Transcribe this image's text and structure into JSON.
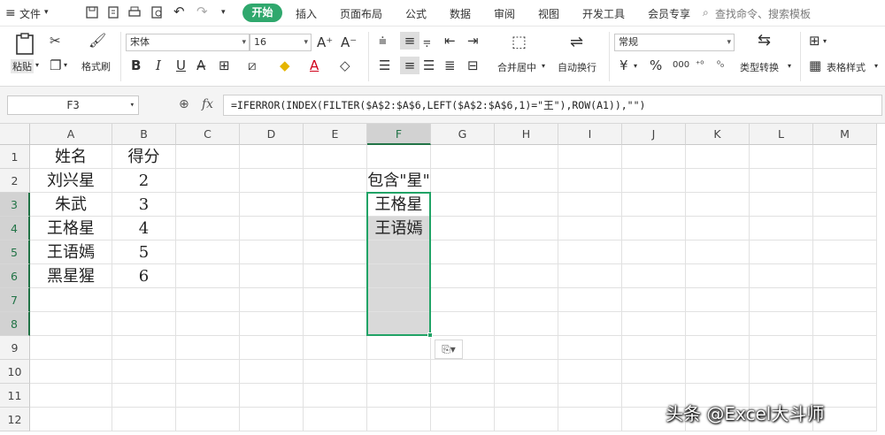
{
  "menubar": {
    "file": "文件",
    "tabs": [
      "开始",
      "插入",
      "页面布局",
      "公式",
      "数据",
      "审阅",
      "视图",
      "开发工具",
      "会员专享"
    ],
    "search": "查找命令、搜索模板"
  },
  "ribbon": {
    "paste": "粘贴",
    "format_painter": "格式刷",
    "font_name": "宋体",
    "font_size": "16",
    "merge_center": "合并居中",
    "wrap_text": "自动换行",
    "number_format": "常规",
    "type_convert": "类型转换",
    "table_style": "表格样式"
  },
  "formula_bar": {
    "name_box": "F3",
    "fx": "fx",
    "formula": "=IFERROR(INDEX(FILTER($A$2:$A$6,LEFT($A$2:$A$6,1)=\"王\"),ROW(A1)),\"\")"
  },
  "sheet": {
    "columns": [
      "A",
      "B",
      "C",
      "D",
      "E",
      "F",
      "G",
      "H",
      "I",
      "J",
      "K",
      "L",
      "M"
    ],
    "rows": [
      "1",
      "2",
      "3",
      "4",
      "5",
      "6",
      "7",
      "8",
      "9",
      "10",
      "11",
      "12"
    ],
    "cells": {
      "A1": "姓名",
      "B1": "得分",
      "A2": "刘兴星",
      "B2": "2",
      "A3": "朱武",
      "B3": "3",
      "A4": "王格星",
      "B4": "4",
      "A5": "王语嫣",
      "B5": "5",
      "A6": "黑星猩",
      "B6": "6",
      "F2": "包含\"星\"",
      "F3": "王格星",
      "F4": "王语嫣"
    },
    "selected_range": "F3:F8",
    "accent": "#21a366"
  },
  "watermark": "头条 @Excel大斗师"
}
